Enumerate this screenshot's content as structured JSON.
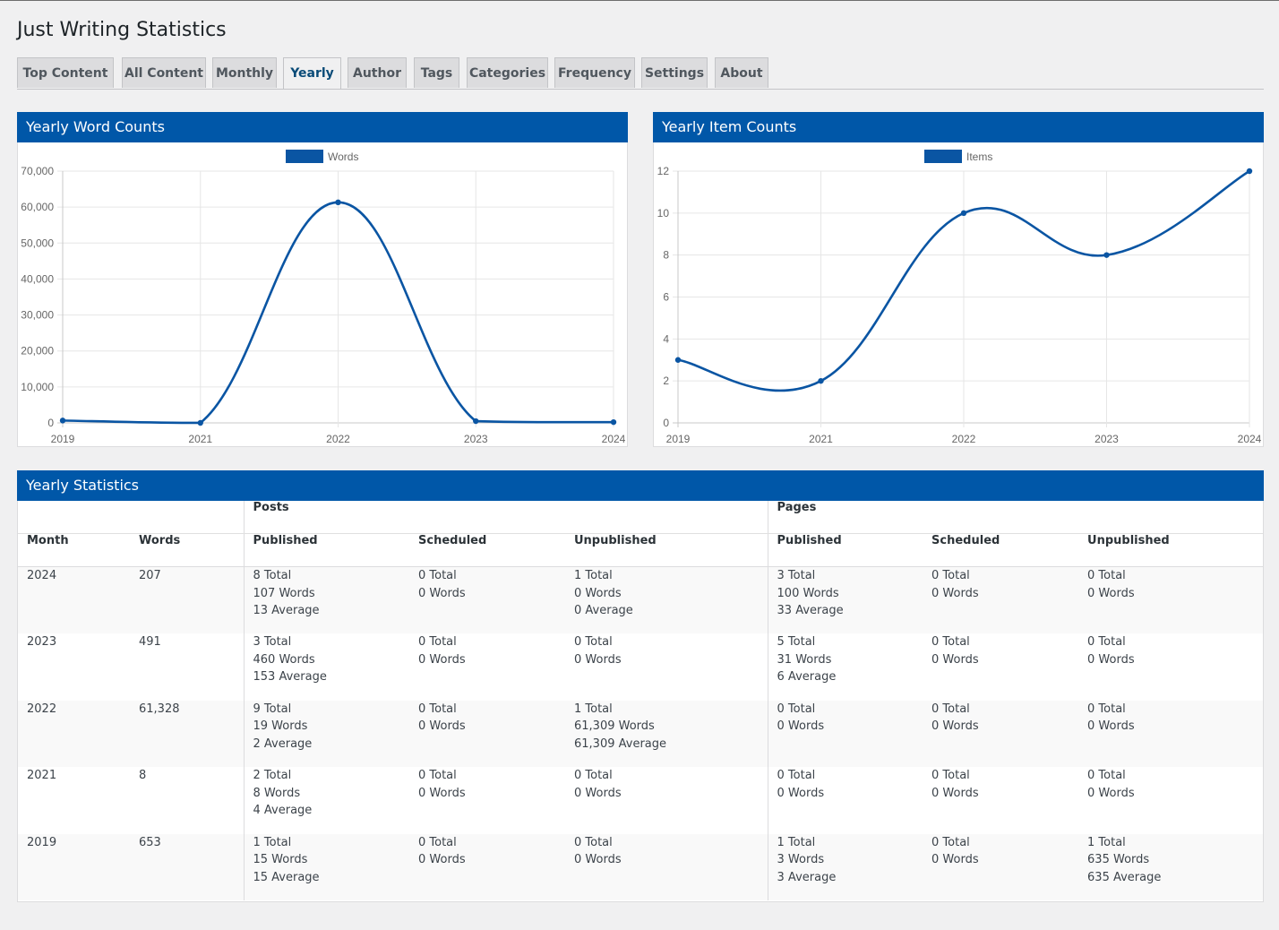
{
  "page_title": "Just Writing Statistics",
  "tabs": [
    "Top Content",
    "All Content",
    "Monthly",
    "Yearly",
    "Author",
    "Tags",
    "Categories",
    "Frequency",
    "Settings",
    "About"
  ],
  "active_tab": "Yearly",
  "colors": {
    "accent": "#0057a8",
    "line": "#0a55a3"
  },
  "word_chart": {
    "title": "Yearly Word Counts",
    "chart_data": {
      "type": "line",
      "x": [
        "2019",
        "2021",
        "2022",
        "2023",
        "2024"
      ],
      "series": [
        {
          "name": "Words",
          "values": [
            653,
            8,
            61328,
            491,
            207
          ]
        }
      ],
      "ylim": [
        0,
        70000
      ],
      "yticks": [
        "70,000",
        "60,000",
        "50,000",
        "40,000",
        "30,000",
        "20,000",
        "10,000",
        "0"
      ],
      "grid": true,
      "legend": "top-center"
    }
  },
  "item_chart": {
    "title": "Yearly Item Counts",
    "chart_data": {
      "type": "line",
      "x": [
        "2019",
        "2021",
        "2022",
        "2023",
        "2024"
      ],
      "series": [
        {
          "name": "Items",
          "values": [
            3,
            2,
            10,
            8,
            12
          ]
        }
      ],
      "ylim": [
        0,
        12
      ],
      "yticks": [
        "12",
        "10",
        "8",
        "6",
        "4",
        "2",
        "0"
      ],
      "grid": true,
      "legend": "top-center"
    }
  },
  "stats": {
    "title": "Yearly Statistics",
    "group_posts": "Posts",
    "group_pages": "Pages",
    "columns": [
      "Month",
      "Words",
      "Published",
      "Scheduled",
      "Unpublished",
      "Published",
      "Scheduled",
      "Unpublished"
    ],
    "rows": [
      {
        "year": "2024",
        "words": "207",
        "cells": [
          [
            "8 Total",
            "107 Words",
            "13 Average"
          ],
          [
            "0 Total",
            "0 Words"
          ],
          [
            "1 Total",
            "0 Words",
            "0 Average"
          ],
          [
            "3 Total",
            "100 Words",
            "33 Average"
          ],
          [
            "0 Total",
            "0 Words"
          ],
          [
            "0 Total",
            "0 Words"
          ]
        ]
      },
      {
        "year": "2023",
        "words": "491",
        "cells": [
          [
            "3 Total",
            "460 Words",
            "153 Average"
          ],
          [
            "0 Total",
            "0 Words"
          ],
          [
            "0 Total",
            "0 Words"
          ],
          [
            "5 Total",
            "31 Words",
            "6 Average"
          ],
          [
            "0 Total",
            "0 Words"
          ],
          [
            "0 Total",
            "0 Words"
          ]
        ]
      },
      {
        "year": "2022",
        "words": "61,328",
        "cells": [
          [
            "9 Total",
            "19 Words",
            "2 Average"
          ],
          [
            "0 Total",
            "0 Words"
          ],
          [
            "1 Total",
            "61,309 Words",
            "61,309 Average"
          ],
          [
            "0 Total",
            "0 Words"
          ],
          [
            "0 Total",
            "0 Words"
          ],
          [
            "0 Total",
            "0 Words"
          ]
        ]
      },
      {
        "year": "2021",
        "words": "8",
        "cells": [
          [
            "2 Total",
            "8 Words",
            "4 Average"
          ],
          [
            "0 Total",
            "0 Words"
          ],
          [
            "0 Total",
            "0 Words"
          ],
          [
            "0 Total",
            "0 Words"
          ],
          [
            "0 Total",
            "0 Words"
          ],
          [
            "0 Total",
            "0 Words"
          ]
        ]
      },
      {
        "year": "2019",
        "words": "653",
        "cells": [
          [
            "1 Total",
            "15 Words",
            "15 Average"
          ],
          [
            "0 Total",
            "0 Words"
          ],
          [
            "0 Total",
            "0 Words"
          ],
          [
            "1 Total",
            "3 Words",
            "3 Average"
          ],
          [
            "0 Total",
            "0 Words"
          ],
          [
            "1 Total",
            "635 Words",
            "635 Average"
          ]
        ]
      }
    ]
  }
}
